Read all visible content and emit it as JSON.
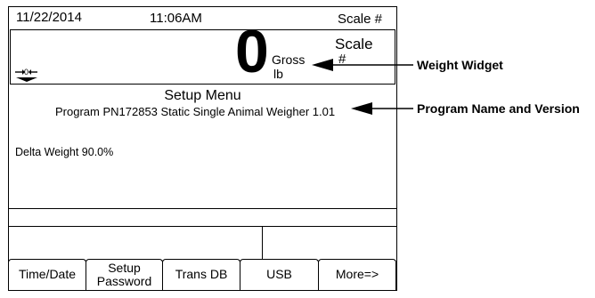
{
  "status_bar": {
    "date": "11/22/2014",
    "time": "11:06AM",
    "scale": "Scale #"
  },
  "weight_widget": {
    "value": "0",
    "mode": "Gross",
    "unit": "lb",
    "scale_label": "Scale",
    "scale_number": "#"
  },
  "setup_menu": {
    "title": "Setup Menu",
    "program": "Program PN172853 Static Single Animal Weigher 1.01",
    "delta_weight": "Delta Weight 90.0%"
  },
  "softkeys": [
    {
      "label": "Time/Date"
    },
    {
      "label": "Setup\nPassword"
    },
    {
      "label": "Trans DB"
    },
    {
      "label": "USB"
    },
    {
      "label": "More=>"
    }
  ],
  "callouts": {
    "weight_widget": "Weight Widget",
    "program_name": "Program Name and Version"
  },
  "icons": {
    "zero_indicator": "center-of-zero-icon"
  }
}
